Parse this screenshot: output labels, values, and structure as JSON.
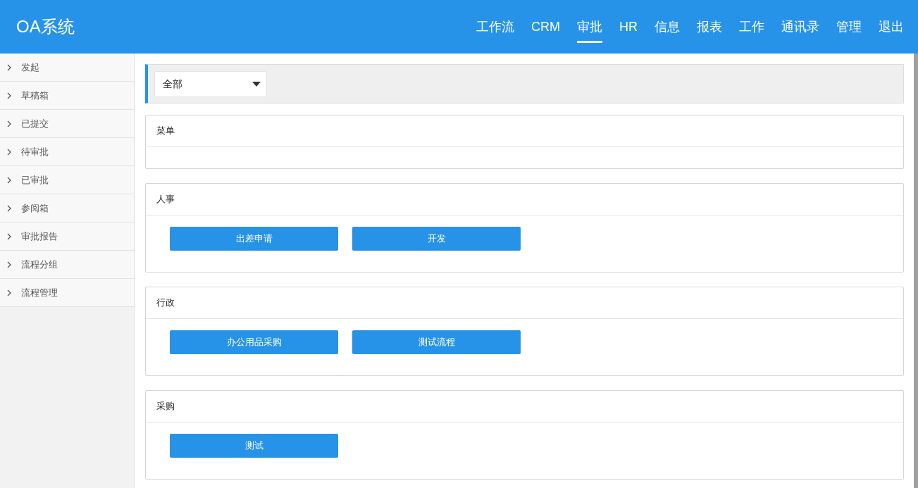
{
  "app_title": "OA系统",
  "nav": [
    {
      "label": "工作流",
      "selected": false
    },
    {
      "label": "CRM",
      "selected": false
    },
    {
      "label": "审批",
      "selected": true
    },
    {
      "label": "HR",
      "selected": false
    },
    {
      "label": "信息",
      "selected": false
    },
    {
      "label": "报表",
      "selected": false
    },
    {
      "label": "工作",
      "selected": false
    },
    {
      "label": "通讯录",
      "selected": false
    },
    {
      "label": "管理",
      "selected": false
    },
    {
      "label": "退出",
      "selected": false
    }
  ],
  "sidebar": {
    "items": [
      "发起",
      "草稿箱",
      "已提交",
      "待审批",
      "已审批",
      "参阅箱",
      "审批报告",
      "流程分组",
      "流程管理"
    ]
  },
  "filter": {
    "value": "全部"
  },
  "groups": [
    {
      "title": "菜单"
    },
    {
      "title": "人事",
      "buttons": [
        "出差申请",
        "开发"
      ]
    },
    {
      "title": "行政",
      "buttons": [
        "办公用品采购",
        "测试流程"
      ]
    },
    {
      "title": "采购",
      "buttons": [
        "测试"
      ]
    }
  ]
}
